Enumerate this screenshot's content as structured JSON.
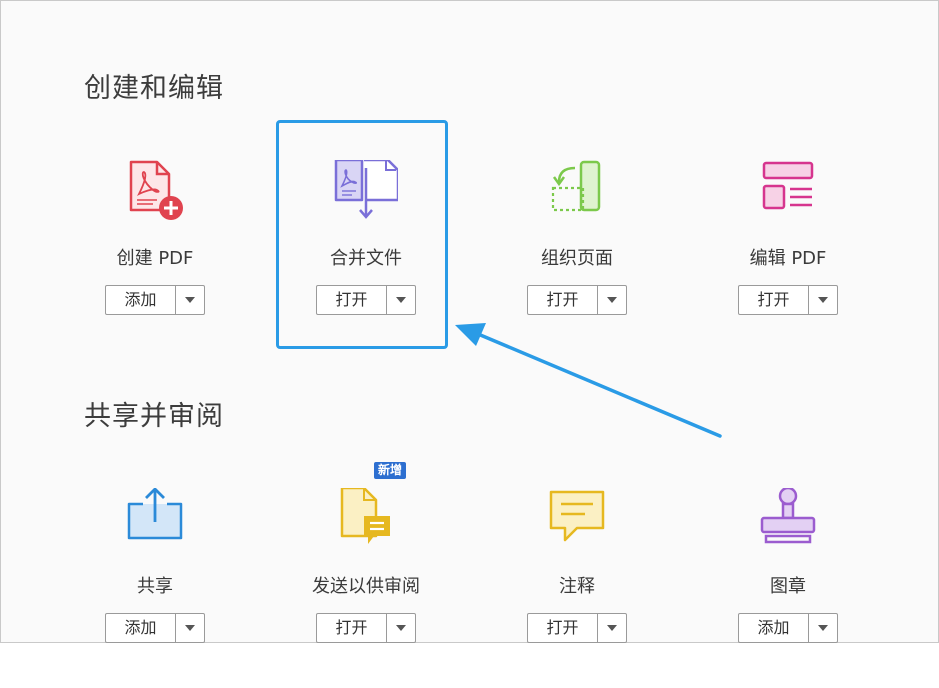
{
  "sections": {
    "create": {
      "title": "创建和编辑"
    },
    "share": {
      "title": "共享并审阅"
    }
  },
  "tools": {
    "create_pdf": {
      "name": "创建 PDF",
      "button": "添加",
      "icon": "pdf-add-icon",
      "color": "#e0434f"
    },
    "combine": {
      "name": "合并文件",
      "button": "打开",
      "icon": "combine-files-icon",
      "color": "#7a6fd8"
    },
    "organize": {
      "name": "组织页面",
      "button": "打开",
      "icon": "organize-pages-icon",
      "color": "#7cc94b"
    },
    "edit_pdf": {
      "name": "编辑 PDF",
      "button": "打开",
      "icon": "edit-pdf-icon",
      "color": "#d6358e"
    },
    "share": {
      "name": "共享",
      "button": "添加",
      "icon": "share-icon",
      "color": "#2b8ad8"
    },
    "send_review": {
      "name": "发送以供审阅",
      "button": "打开",
      "icon": "send-for-review-icon",
      "color": "#e6b820",
      "badge": "新增"
    },
    "comment": {
      "name": "注释",
      "button": "打开",
      "icon": "comment-icon",
      "color": "#e6b820"
    },
    "stamp": {
      "name": "图章",
      "button": "添加",
      "icon": "stamp-icon",
      "color": "#9b5ccf"
    }
  },
  "accent": "#2a9be6"
}
